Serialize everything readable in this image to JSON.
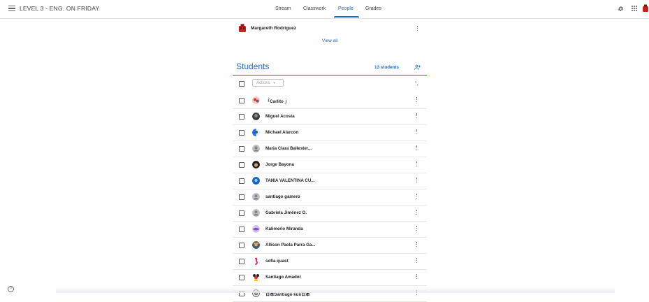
{
  "header": {
    "class_title": "LEVEL 3 - ENG. ON FRIDAY",
    "tabs": [
      {
        "label": "Stream",
        "active": false
      },
      {
        "label": "Classwork",
        "active": false
      },
      {
        "label": "People",
        "active": true
      },
      {
        "label": "Grades",
        "active": false
      }
    ],
    "icons": [
      "menu-icon",
      "gear-icon",
      "apps-grid-icon",
      "account-avatar-icon"
    ]
  },
  "teachers": {
    "last_visible": {
      "name": "Margareth Rodriguez",
      "avatar": "red-robot-avatar"
    },
    "view_all_label": "View all"
  },
  "students": {
    "title": "Students",
    "count_label": "13 students",
    "actions_label": "Actions",
    "list": [
      {
        "name": "「Carlito 」",
        "avatar": "cartoon-avatar"
      },
      {
        "name": "Miguel Acosta",
        "avatar": "photo-avatar"
      },
      {
        "name": "Michael Alarcon",
        "avatar": "photo-avatar"
      },
      {
        "name": "Maria Clara Ballester...",
        "avatar": "default-avatar"
      },
      {
        "name": "Jorge Bayona",
        "avatar": "photo-avatar"
      },
      {
        "name": "TANIA VALENTINA CU...",
        "avatar": "photo-avatar"
      },
      {
        "name": "santiago gamero",
        "avatar": "default-avatar"
      },
      {
        "name": "Gabriela Jiménez O.",
        "avatar": "default-avatar"
      },
      {
        "name": "Kalimerio Miranda",
        "avatar": "photo-avatar"
      },
      {
        "name": "Allison Paola Parra Ga...",
        "avatar": "photo-avatar"
      },
      {
        "name": "sofia quast",
        "avatar": "flamingo-avatar"
      },
      {
        "name": "Santiago Amador",
        "avatar": "cartoon-avatar"
      },
      {
        "name": "日本Santiago kun日本",
        "avatar": "cartoon-avatar"
      }
    ]
  },
  "colors": {
    "accent": "#1967d2",
    "text": "#202124",
    "divider": "#e8eaed"
  }
}
